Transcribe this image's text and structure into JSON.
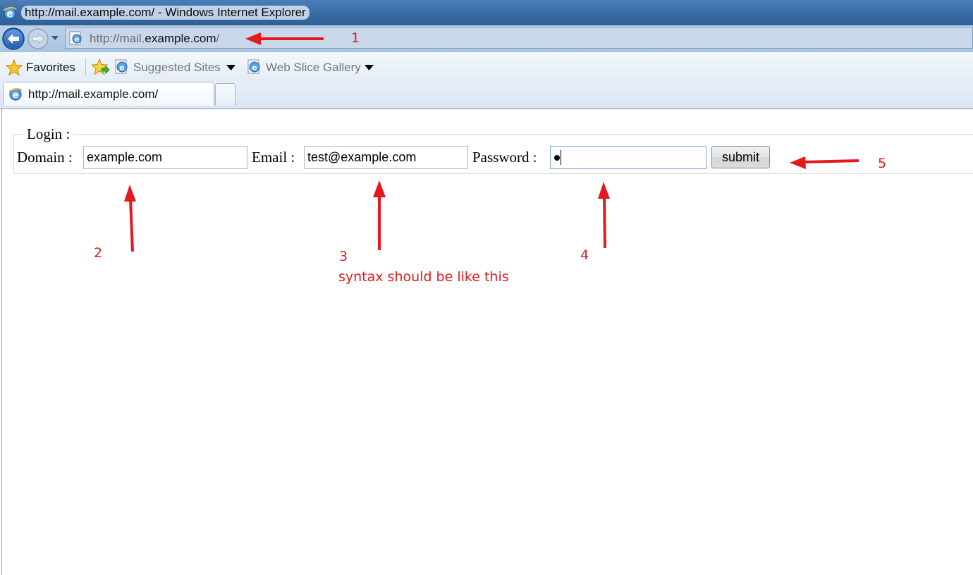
{
  "window": {
    "title": "http://mail.example.com/ - Windows Internet Explorer"
  },
  "address_bar": {
    "url_prefix": "http://mail.",
    "url_domain": "example.com",
    "url_suffix": "/"
  },
  "favorites_bar": {
    "favorites_label": "Favorites",
    "suggested_sites_label": "Suggested Sites",
    "web_slice_gallery_label": "Web Slice Gallery"
  },
  "tabs": [
    {
      "label": "http://mail.example.com/",
      "active": true
    }
  ],
  "login_form": {
    "legend": "Login :",
    "domain_label": "Domain :",
    "domain_value": "example.com",
    "email_label": "Email :",
    "email_value": "test@example.com",
    "password_label": "Password :",
    "password_masked_length": 1,
    "submit_label": "submit"
  },
  "annotations": {
    "color": "#e4191c",
    "labels": [
      "1",
      "2",
      "3",
      "4",
      "5"
    ],
    "note": "syntax should be like this"
  },
  "icons": [
    "ie-icon",
    "back-arrow-icon",
    "forward-arrow-icon",
    "star-icon",
    "add-favorite-icon",
    "page-ie-icon",
    "dropdown-caret-icon"
  ]
}
